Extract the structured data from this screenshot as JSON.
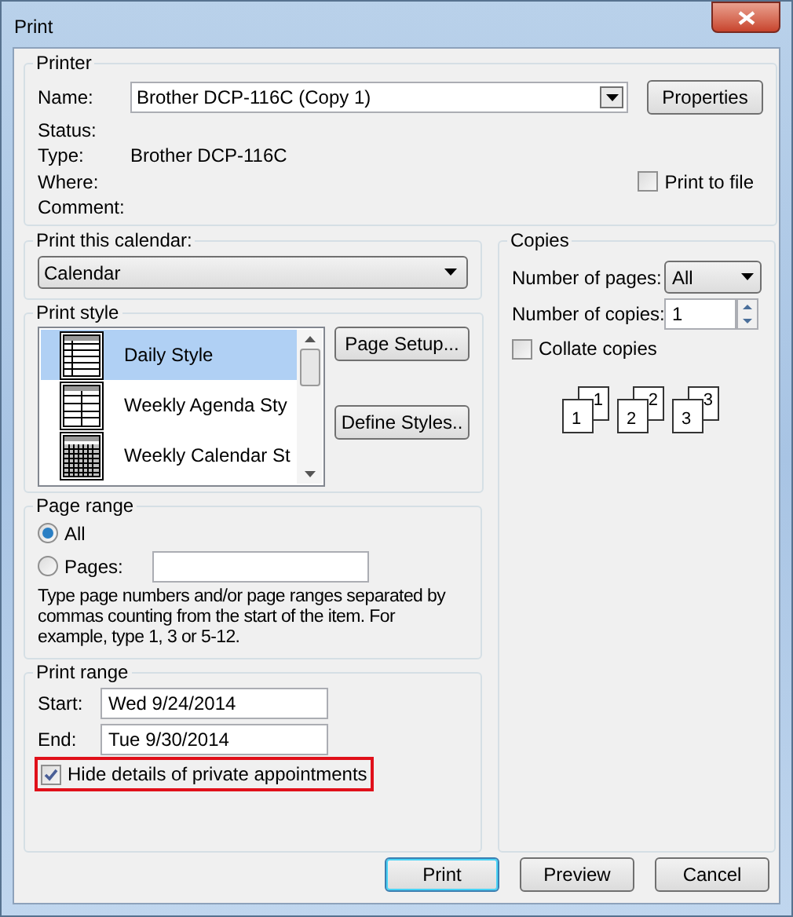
{
  "window": {
    "title": "Print"
  },
  "printer": {
    "group_title": "Printer",
    "name_label": "Name:",
    "name_value": "Brother DCP-116C (Copy 1)",
    "properties_button": "Properties",
    "info": [
      {
        "label": "Status:"
      },
      {
        "label": "Type:",
        "value": "Brother DCP-116C"
      },
      {
        "label": "Where:"
      },
      {
        "label": "Comment:"
      }
    ],
    "print_to_file": {
      "label": "Print to file",
      "checked": false
    }
  },
  "calendar": {
    "group_title": "Print this calendar:",
    "value": "Calendar"
  },
  "print_style": {
    "group_title": "Print style",
    "items": [
      {
        "label": "Daily Style",
        "selected": true
      },
      {
        "label": "Weekly Agenda Sty",
        "selected": false
      },
      {
        "label": "Weekly Calendar St",
        "selected": false
      }
    ],
    "buttons": [
      "Page Setup...",
      "Define Styles.."
    ]
  },
  "copies": {
    "group_title": "Copies",
    "pages_label": "Number of pages:",
    "pages_value": "All",
    "copies_label": "Number of copies:",
    "copies_value": "1",
    "collate": {
      "label": "Collate copies",
      "checked": false
    },
    "stacks": [
      {
        "back": "1",
        "front": "1"
      },
      {
        "back": "2",
        "front": "2"
      },
      {
        "back": "3",
        "front": "3"
      }
    ]
  },
  "page_range": {
    "group_title": "Page range",
    "options": [
      {
        "label": "All",
        "selected": true
      },
      {
        "label": "Pages:",
        "selected": false
      }
    ],
    "hint": "Type page numbers and/or page ranges separated by commas counting from the start of the item.  For example, type 1, 3 or 5-12."
  },
  "print_range": {
    "group_title": "Print range",
    "start_label": "Start:",
    "start_value": "Wed 9/24/2014",
    "end_label": "End:",
    "end_value": "Tue 9/30/2014",
    "hide_private": {
      "label": "Hide details of private appointments",
      "checked": true,
      "highlighted": true
    }
  },
  "buttons": [
    {
      "label": "Print",
      "default": true
    },
    {
      "label": "Preview",
      "default": false
    },
    {
      "label": "Cancel",
      "default": false
    }
  ]
}
